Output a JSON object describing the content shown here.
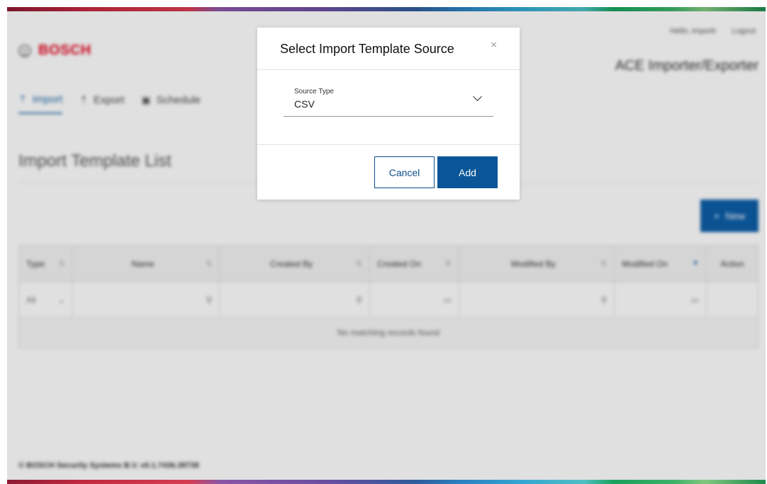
{
  "header": {
    "brand": "BOSCH",
    "greeting": "Hello, importr",
    "logout": "Logout",
    "app_title": "ACE Importer/Exporter"
  },
  "nav": {
    "items": [
      {
        "label": "Import",
        "icon": "upload-icon",
        "active": true
      },
      {
        "label": "Export",
        "icon": "upload-icon",
        "active": false
      },
      {
        "label": "Schedule",
        "icon": "calendar-icon",
        "active": false
      }
    ]
  },
  "main": {
    "title": "Import Template List",
    "new_button": "New"
  },
  "grid": {
    "columns": [
      "Type",
      "Name",
      "Created By",
      "Created On",
      "Modified By",
      "Modified On",
      "Action"
    ],
    "type_filter": "All",
    "empty_message": "No matching records found"
  },
  "footer": {
    "text": "© BOSCH Security Systems B.V. v0.1.7436.38738"
  },
  "modal": {
    "title": "Select Import Template Source",
    "close_symbol": "×",
    "source_type_label": "Source Type",
    "source_type_value": "CSV",
    "cancel_label": "Cancel",
    "add_label": "Add"
  },
  "colors": {
    "primary": "#0a5698",
    "brand_red": "#e2001a"
  }
}
